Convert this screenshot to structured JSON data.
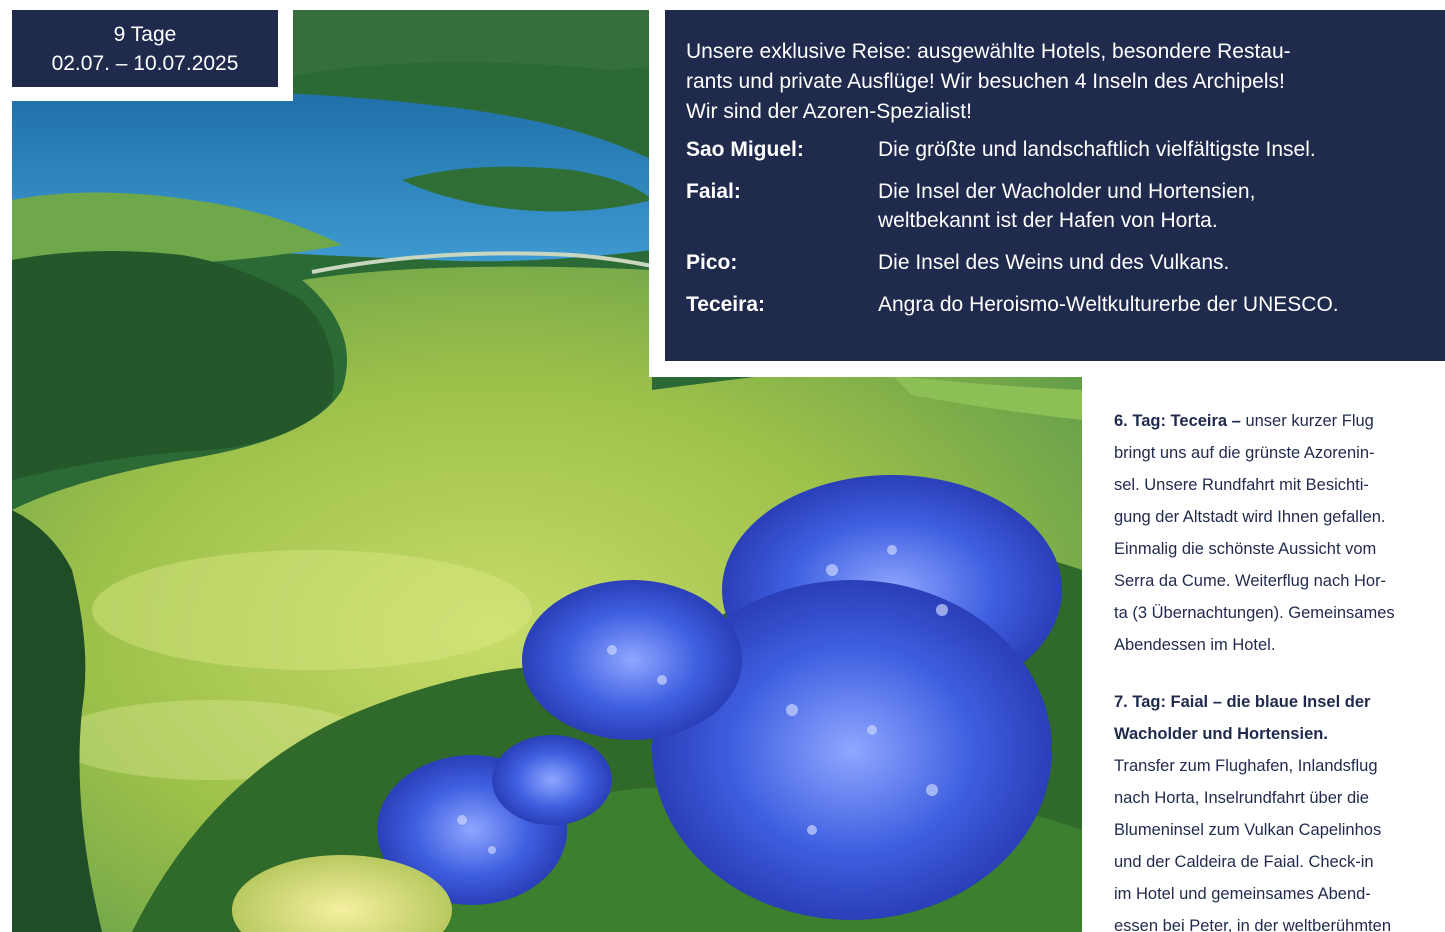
{
  "badge": {
    "duration": "9 Tage",
    "dates": "02.07. – 10.07.2025"
  },
  "info": {
    "intro_lines": [
      "Unsere exklusive Reise: ausgewählte Hotels, besondere Restau-",
      "rants und private Ausflüge! Wir besuchen 4 Inseln des Archipels!",
      "Wir sind der Azoren-Spezialist!"
    ],
    "islands": [
      {
        "name": "Sao Miguel:",
        "description": [
          "Die größte und landschaftlich vielfältigste Insel."
        ]
      },
      {
        "name": "Faial:",
        "description": [
          "Die Insel der Wacholder und Hortensien,",
          "weltbekannt ist der Hafen von Horta."
        ]
      },
      {
        "name": "Pico:",
        "description": [
          "Die Insel des Weins und des Vulkans."
        ]
      },
      {
        "name": "Teceira:",
        "description": [
          "Angra do Heroismo-Weltkulturerbe der UNESCO."
        ]
      }
    ]
  },
  "itinerary": {
    "day6": {
      "heading": "6. Tag: Teceira –",
      "lines": [
        " unser kurzer Flug",
        "bringt uns auf die grünste Azorenin-",
        "sel. Unsere Rundfahrt mit Besichti-",
        "gung der Altstadt wird Ihnen gefallen.",
        "Einmalig die schönste Aussicht vom",
        "Serra da Cume. Weiterflug nach Hor-",
        "ta (3 Übernachtungen). Gemeinsames",
        "Abendessen im Hotel."
      ]
    },
    "day7": {
      "heading_lines": [
        "7. Tag: Faial – die blaue Insel der",
        "Wacholder und Hortensien."
      ],
      "lines": [
        "Transfer zum Flughafen, Inlandsflug",
        "nach Horta, Inselrundfahrt über die",
        "Blumeninsel zum Vulkan Capelinhos",
        "und der Caldeira de Faial. Check-in",
        "im Hotel und gemeinsames Abend-",
        "essen bei Peter, in der weltberühmten"
      ]
    }
  },
  "colors": {
    "navy": "#1f2a4d",
    "lake_green": "#9cc04a",
    "lake_blue": "#2f86bf",
    "hydrangea": "#3f5fe0"
  },
  "photo": {
    "subject": "lagoon-with-hydrangeas-image"
  }
}
